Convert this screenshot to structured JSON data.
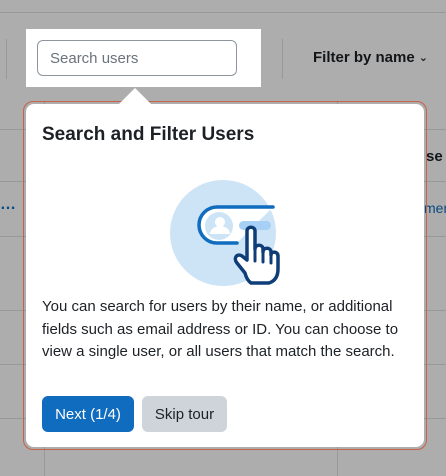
{
  "background": {
    "filter_label": "Filter by name",
    "column_header_partial": "se",
    "row_link_partial": "men",
    "row_actions": "…"
  },
  "search": {
    "placeholder": "Search users"
  },
  "tour": {
    "title": "Search and Filter Users",
    "body": "You can search for users by their name, or additional fields such as email address or ID. You can choose to view a single user, or all users that match the search.",
    "next_label": "Next (1/4)",
    "skip_label": "Skip tour"
  },
  "colors": {
    "primary": "#0f6cbf",
    "secondary": "#ced4da",
    "outline": "#c8614a",
    "illustration_circle": "#cde4f7"
  }
}
